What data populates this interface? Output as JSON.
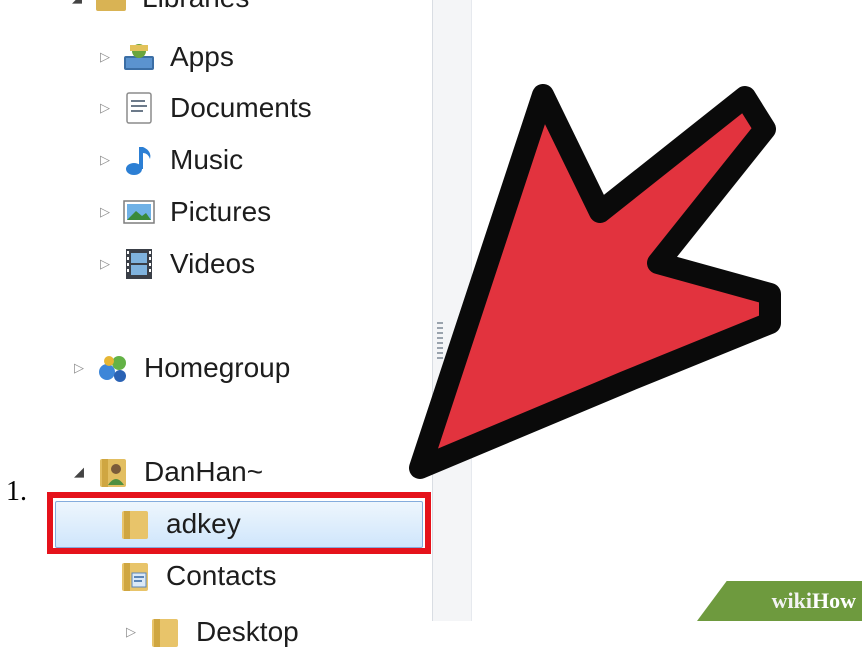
{
  "step_number": "1.",
  "tree": {
    "libraries_label": "Libraries",
    "libraries": [
      {
        "label": "Apps",
        "icon": "apps-icon"
      },
      {
        "label": "Documents",
        "icon": "documents-icon"
      },
      {
        "label": "Music",
        "icon": "music-icon"
      },
      {
        "label": "Pictures",
        "icon": "pictures-icon"
      },
      {
        "label": "Videos",
        "icon": "videos-icon"
      }
    ],
    "homegroup": {
      "label": "Homegroup",
      "icon": "homegroup-icon"
    },
    "user": {
      "label": "DanHan~",
      "icon": "user-folder-icon",
      "children": [
        {
          "label": "adkey",
          "icon": "folder-icon",
          "selected": true
        },
        {
          "label": "Contacts",
          "icon": "contacts-folder-icon"
        },
        {
          "label": "Desktop",
          "icon": "folder-icon"
        }
      ]
    }
  },
  "watermark": {
    "part1": "wiki",
    "part2": "How"
  },
  "colors": {
    "arrow_fill": "#e2333e",
    "arrow_outline": "#0a0a0a",
    "highlight_box": "#e5121b",
    "selection": "#cfe6fb"
  }
}
